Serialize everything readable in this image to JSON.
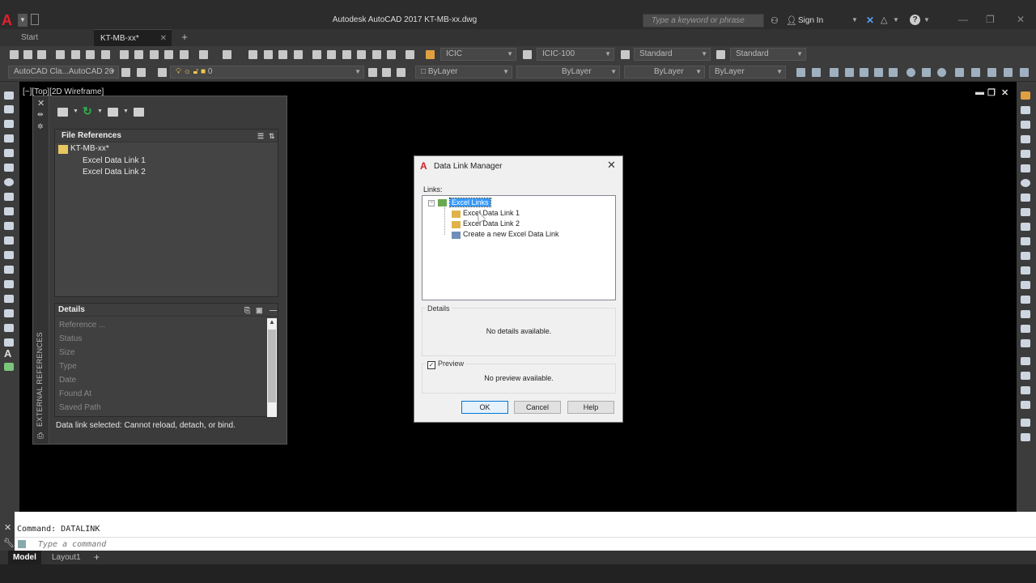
{
  "window": {
    "title": "Autodesk AutoCAD 2017    KT-MB-xx.dwg",
    "search_placeholder": "Type a keyword or phrase",
    "sign_in": "Sign In"
  },
  "tabs": {
    "start": "Start",
    "document": "KT-MB-xx*",
    "add": "+"
  },
  "toolbar1": {
    "text_style": "ICIC",
    "dim_style": "ICIC-100",
    "table_style": "Standard",
    "multileader_style": "Standard"
  },
  "toolbar2": {
    "workspace": "AutoCAD Cla...AutoCAD 20",
    "layer": "0",
    "color": "ByLayer",
    "linetype": "ByLayer",
    "lineweight": "ByLayer",
    "plotstyle": "ByLayer"
  },
  "viewport": {
    "label": "[−][Top][2D Wireframe]"
  },
  "xref_palette": {
    "vertical_title": "EXTERNAL REFERENCES",
    "file_references_header": "File References",
    "tree": {
      "root": "KT-MB-xx*",
      "children": [
        "Excel Data Link 1",
        "Excel Data Link 2"
      ]
    },
    "details_header": "Details",
    "detail_rows": [
      "Reference ...",
      "Status",
      "Size",
      "Type",
      "Date",
      "Found At",
      "Saved Path"
    ],
    "status_message": "Data link selected: Cannot reload, detach, or bind."
  },
  "dialog": {
    "title": "Data Link Manager",
    "links_label": "Links:",
    "tree_root": "Excel Links",
    "tree_items": [
      "Excel Data Link 1",
      "Excel Data Link 2",
      "Create a new Excel Data Link"
    ],
    "details_legend": "Details",
    "details_text": "No details available.",
    "preview_legend": "Preview",
    "preview_checked": true,
    "preview_text": "No preview available.",
    "ok_label": "OK",
    "cancel_label": "Cancel",
    "help_label": "Help"
  },
  "command_line": {
    "history": "Command: DATALINK",
    "input_placeholder": "Type a command"
  },
  "layout_tabs": {
    "model": "Model",
    "layout1": "Layout1",
    "add": "+"
  },
  "colors": {
    "accent_red": "#e8202a",
    "selection_blue": "#3399ff",
    "background": "#000000"
  }
}
